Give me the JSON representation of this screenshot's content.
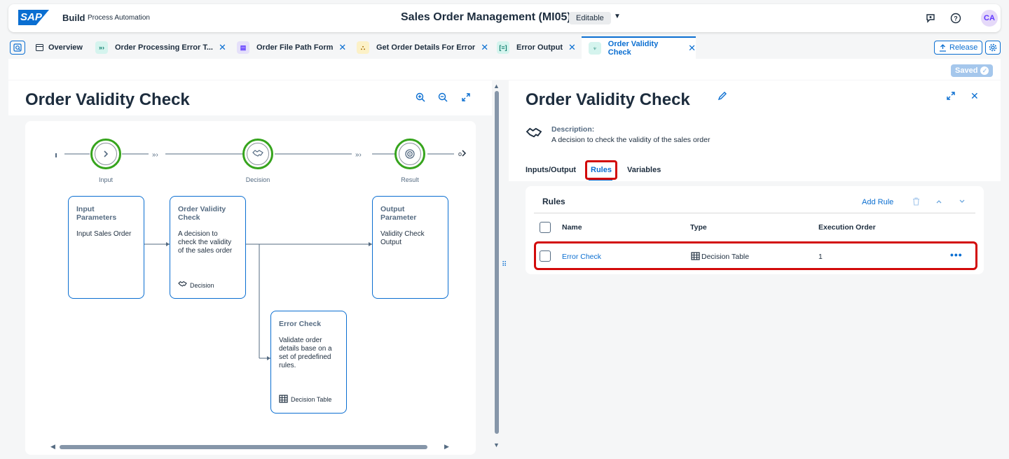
{
  "shell": {
    "logo": "SAP",
    "product": "Build",
    "subproduct": "Process Automation",
    "title": "Sales Order Management (MI05)",
    "badge": "Editable",
    "avatar": "CA"
  },
  "tabs": [
    {
      "label": "Overview"
    },
    {
      "label": "Order Processing Error T..."
    },
    {
      "label": "Order File Path Form"
    },
    {
      "label": "Get Order Details For Error"
    },
    {
      "label": "Error Output"
    },
    {
      "label": "Order Validity Check"
    }
  ],
  "toolbar": {
    "release": "Release",
    "saved": "Saved"
  },
  "left": {
    "title": "Order Validity Check",
    "nodes": {
      "input": "Input",
      "decision": "Decision",
      "result": "Result"
    },
    "cards": {
      "input_title": "Input Parameters",
      "input_body": "Input Sales Order",
      "decision_title": "Order Validity Check",
      "decision_body": "A decision to check the validity of the sales order",
      "decision_footer": "Decision",
      "output_title": "Output Parameter",
      "output_body": "Validity Check Output",
      "error_title": "Error Check",
      "error_body": "Validate order details base on a set of predefined rules.",
      "error_footer": "Decision Table"
    }
  },
  "right": {
    "title": "Order Validity Check",
    "desc_label": "Description:",
    "desc_text": "A decision to check the validity of the sales order",
    "tabs": [
      "Inputs/Output",
      "Rules",
      "Variables"
    ],
    "rules": {
      "title": "Rules",
      "add_rule": "Add Rule",
      "columns": [
        "Name",
        "Type",
        "Execution Order"
      ],
      "rows": [
        {
          "name": "Error Check",
          "type": "Decision Table",
          "order": "1"
        }
      ]
    }
  }
}
